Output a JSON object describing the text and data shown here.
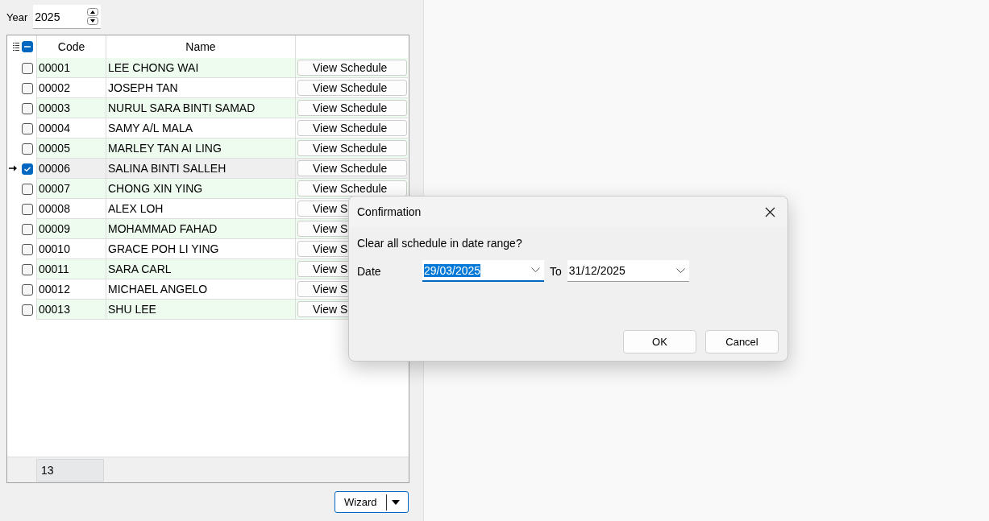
{
  "year": {
    "label": "Year",
    "value": "2025"
  },
  "grid": {
    "columns": [
      "Code",
      "Name"
    ],
    "header_indeterminate": true,
    "rows": [
      {
        "code": "00001",
        "name": "LEE CHONG WAI",
        "action": "View Schedule",
        "checked": false,
        "selected": false
      },
      {
        "code": "00002",
        "name": "JOSEPH TAN",
        "action": "View Schedule",
        "checked": false,
        "selected": false
      },
      {
        "code": "00003",
        "name": "NURUL SARA BINTI SAMAD",
        "action": "View Schedule",
        "checked": false,
        "selected": false
      },
      {
        "code": "00004",
        "name": "SAMY A/L MALA",
        "action": "View Schedule",
        "checked": false,
        "selected": false
      },
      {
        "code": "00005",
        "name": "MARLEY TAN AI LING",
        "action": "View Schedule",
        "checked": false,
        "selected": false
      },
      {
        "code": "00006",
        "name": "SALINA BINTI SALLEH",
        "action": "View Schedule",
        "checked": true,
        "selected": true
      },
      {
        "code": "00007",
        "name": "CHONG XIN YING",
        "action": "View Schedule",
        "checked": false,
        "selected": false
      },
      {
        "code": "00008",
        "name": "ALEX LOH",
        "action": "View S",
        "checked": false,
        "selected": false
      },
      {
        "code": "00009",
        "name": "MOHAMMAD FAHAD",
        "action": "View S",
        "checked": false,
        "selected": false
      },
      {
        "code": "00010",
        "name": "GRACE POH LI YING",
        "action": "View S",
        "checked": false,
        "selected": false
      },
      {
        "code": "00011",
        "name": "SARA CARL",
        "action": "View S",
        "checked": false,
        "selected": false
      },
      {
        "code": "00012",
        "name": "MICHAEL ANGELO",
        "action": "View S",
        "checked": false,
        "selected": false
      },
      {
        "code": "00013",
        "name": "SHU LEE",
        "action": "View S",
        "checked": false,
        "selected": false
      }
    ],
    "footer_count": "13"
  },
  "wizard_button": "Wizard",
  "dialog": {
    "title": "Confirmation",
    "message": "Clear all schedule in date range?",
    "date_label": "Date",
    "from": "29/03/2025",
    "to_label": "To",
    "to": "31/12/2025",
    "buttons": [
      "OK",
      "Cancel"
    ]
  }
}
